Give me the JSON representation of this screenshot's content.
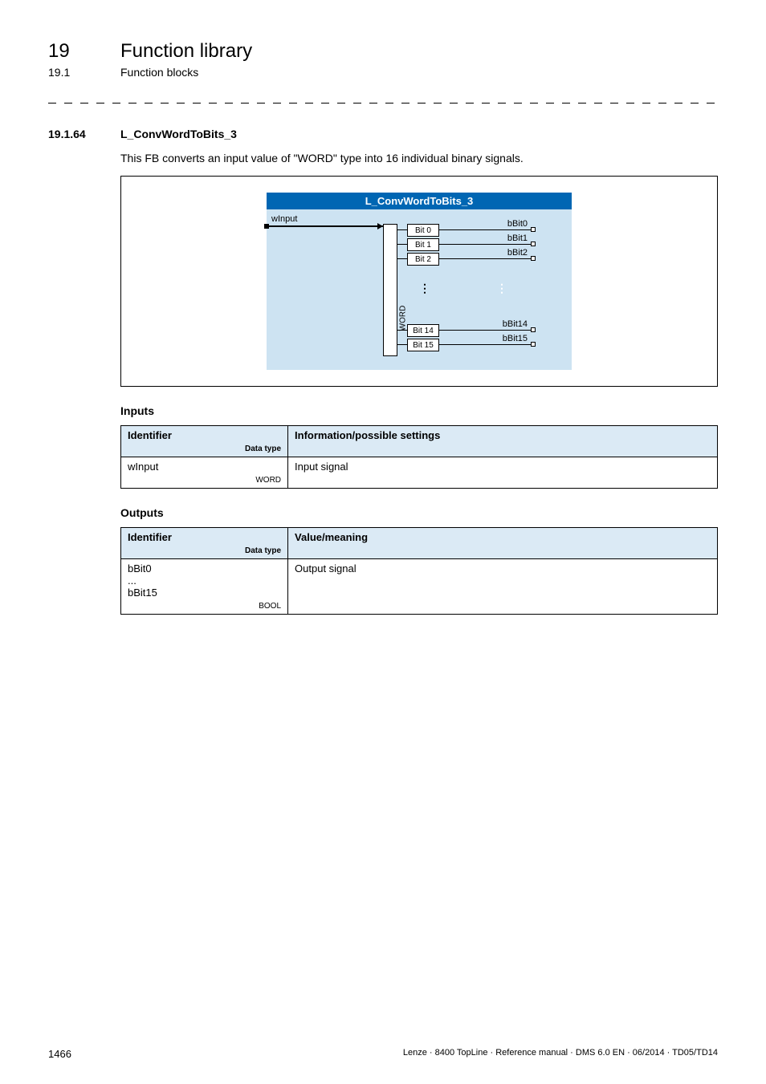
{
  "header": {
    "chapter_num": "19",
    "chapter_title": "Function library",
    "sub_num": "19.1",
    "sub_title": "Function blocks"
  },
  "section": {
    "num": "19.1.64",
    "title": "L_ConvWordToBits_3",
    "description": "This FB converts an input value of \"WORD\" type into 16 individual binary signals."
  },
  "figure": {
    "block_title": "L_ConvWordToBits_3",
    "input_label": "wInput",
    "word_label": "WORD",
    "bit_labels_top": [
      "Bit 0",
      "Bit 1",
      "Bit 2"
    ],
    "bit_labels_bottom": [
      "Bit 14",
      "Bit 15"
    ],
    "out_labels_top": [
      "bBit0",
      "bBit1",
      "bBit2"
    ],
    "out_labels_bottom": [
      "bBit14",
      "bBit15"
    ]
  },
  "inputs_table": {
    "heading": "Inputs",
    "col1": "Identifier",
    "col1_sub": "Data type",
    "col2": "Information/possible settings",
    "rows": [
      {
        "id": "wInput",
        "type": "WORD",
        "info": "Input signal"
      }
    ]
  },
  "outputs_table": {
    "heading": "Outputs",
    "col1": "Identifier",
    "col1_sub": "Data type",
    "col2": "Value/meaning",
    "rows": [
      {
        "id_line1": "bBit0",
        "id_line2": "...",
        "id_line3": "bBit15",
        "type": "BOOL",
        "info": "Output signal"
      }
    ]
  },
  "footer": {
    "page": "1466",
    "right": "Lenze · 8400 TopLine · Reference manual · DMS 6.0 EN · 06/2014 · TD05/TD14"
  }
}
